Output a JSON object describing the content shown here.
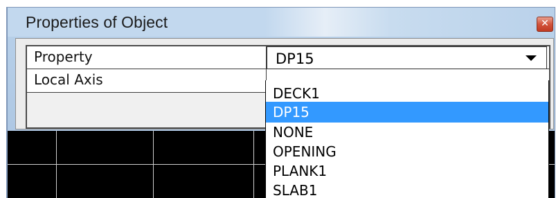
{
  "window": {
    "title": "Properties of Object"
  },
  "properties": {
    "rows": [
      {
        "label": "Property",
        "value": "DP15"
      },
      {
        "label": "Local Axis",
        "value": ""
      }
    ]
  },
  "dropdown": {
    "selected": "DP15",
    "options": [
      "DECK1",
      "DP15",
      "NONE",
      "OPENING",
      "PLANK1",
      "SLAB1"
    ]
  },
  "colors": {
    "selection": "#3399ff",
    "titlebar": "#c2d8ee",
    "canvas": "#000000"
  }
}
